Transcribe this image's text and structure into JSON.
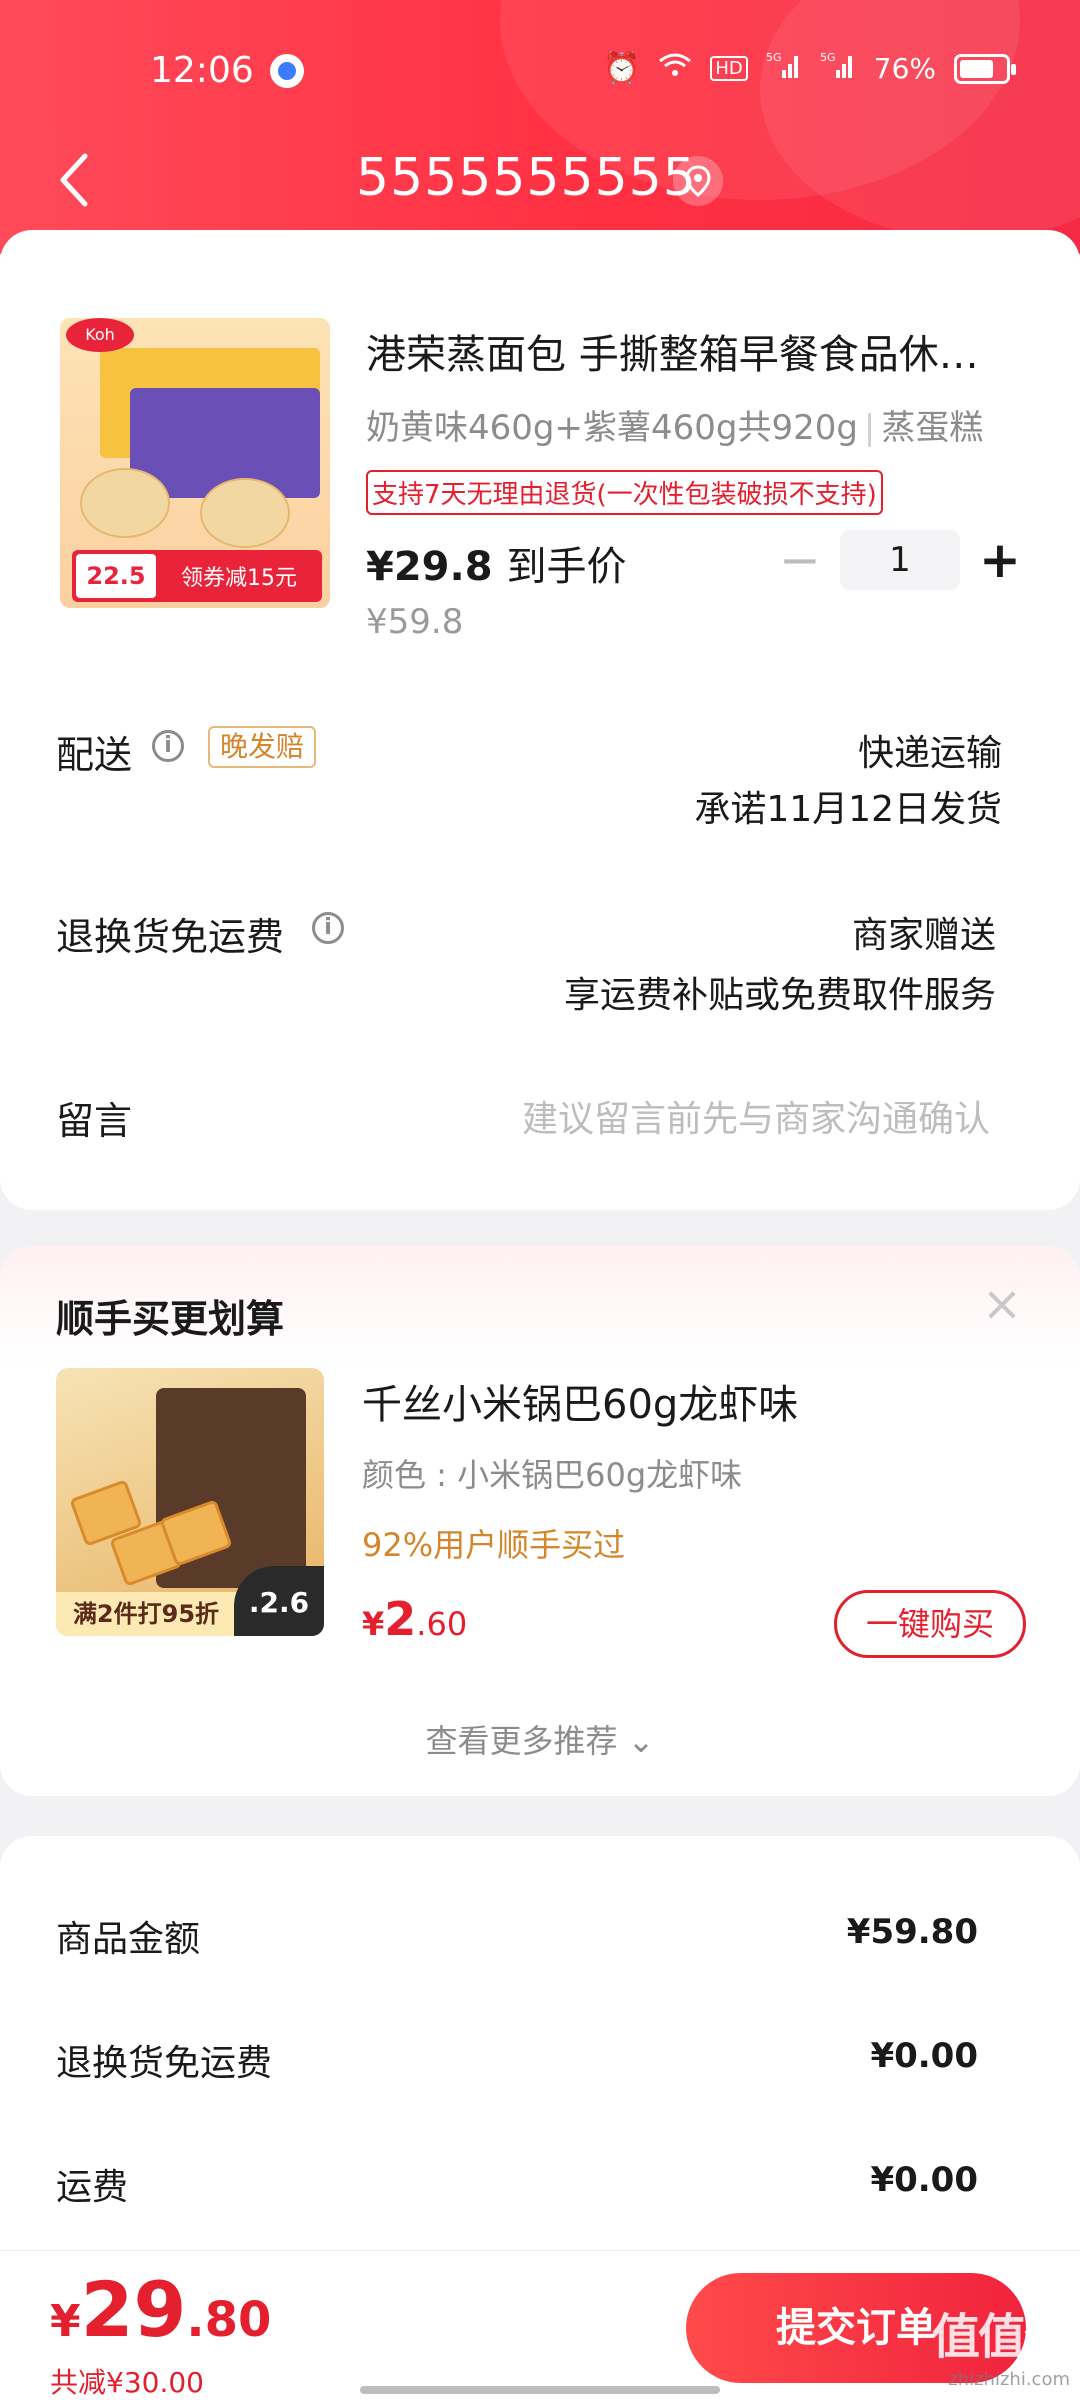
{
  "status_bar": {
    "time": "12:06",
    "battery": "76%",
    "battery_level": 0.76,
    "icons": [
      "alarm-icon",
      "wifi-icon",
      "hd-icon",
      "signal-5g-icon",
      "signal-5g-icon"
    ]
  },
  "header": {
    "title": "5555555555"
  },
  "product": {
    "title": "港荣蒸面包 手撕整箱早餐食品休…",
    "spec": "奶黄味460g+紫薯460g共920g",
    "category": "蒸蛋糕",
    "return_policy": "支持7天无理由退货(一次性包装破损不支持)",
    "price": "¥29.8",
    "price_label": "到手价",
    "original_price": "¥59.8",
    "quantity": "1",
    "image_badge_price": "22.5",
    "image_badge_text": "领券减15元"
  },
  "delivery": {
    "label": "配送",
    "tag": "晚发赔",
    "method": "快递运输",
    "promise": "承诺11月12日发货"
  },
  "return_shipping": {
    "label": "退换货免运费",
    "provider": "商家赠送",
    "detail": "享运费补贴或免费取件服务"
  },
  "remark": {
    "label": "留言",
    "placeholder": "建议留言前先与商家沟通确认"
  },
  "recommend": {
    "title": "顺手买更划算",
    "item_name": "千丝小米锅巴60g龙虾味",
    "item_spec": "颜色 : 小米锅巴60g龙虾味",
    "item_pct": "92%用户顺手买过",
    "price_currency": "¥",
    "price_int": "2",
    "price_dec": ".60",
    "buy_label": "一键购买",
    "image_promo": "满2件打95折",
    "image_price": ".2.6",
    "more_label": "查看更多推荐 ⌄"
  },
  "summary": {
    "rows": [
      {
        "label": "商品金额",
        "value": "¥59.80"
      },
      {
        "label": "退换货免运费",
        "value": "¥0.00"
      },
      {
        "label": "运费",
        "value": "¥0.00"
      }
    ]
  },
  "bottom_bar": {
    "total_currency": "¥",
    "total_int": "29",
    "total_dec": ".80",
    "saved": "共减¥30.00",
    "submit_label": "提交订单",
    "watermark": "值值值",
    "watermark_sub": "zhizhizhi.com"
  },
  "colors": {
    "brand_red": "#e4202e",
    "header_red": "#ff3042",
    "tag_orange": "#d4862b"
  }
}
